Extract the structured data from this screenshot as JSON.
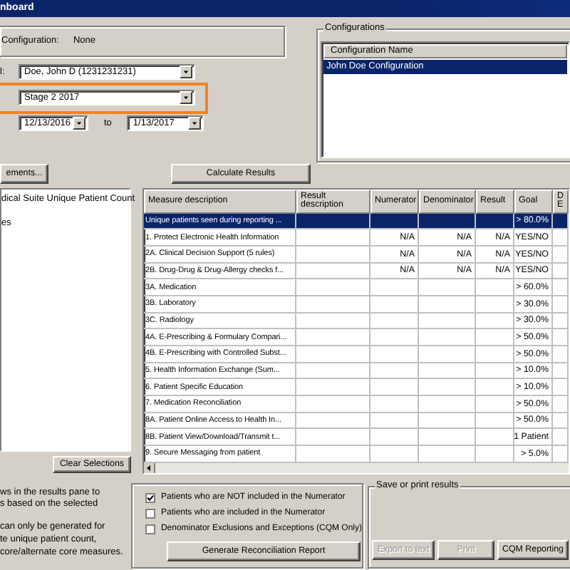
{
  "window": {
    "title": "nboard"
  },
  "configuration": {
    "label": "Configuration:",
    "value": "None"
  },
  "provider": {
    "label": "l:",
    "value": "Doe, John D (1231231231)"
  },
  "stage": {
    "value": "Stage 2 2017",
    "highlighted": true
  },
  "date_range": {
    "from": "12/13/2016",
    "separator": "to",
    "to": "1/13/2017"
  },
  "buttons": [
    {
      "label": "ements...",
      "disabled": false
    },
    {
      "label": "Calculate Results",
      "disabled": false
    }
  ],
  "configurations": {
    "title": "Configurations",
    "column": "Configuration Name",
    "items": [
      {
        "name": "John Doe Configuration",
        "selected": true
      }
    ]
  },
  "measure_list": {
    "items": [
      "dical Suite Unique Patient Count",
      "es"
    ]
  },
  "clear_button": {
    "label": "Clear Selections",
    "disabled": false
  },
  "table": {
    "columns": [
      "Measure description",
      "Result description",
      "Numerator",
      "Denominator",
      "Result",
      "Goal",
      "D E"
    ],
    "rows": [
      {
        "measure": "Unique patients seen during reporting ...",
        "goal": "> 80.0%",
        "selected": true
      },
      {
        "measure": "1. Protect Electronic Health Information",
        "numerator": "N/A",
        "denominator": "N/A",
        "result": "N/A",
        "goal": "YES/NO",
        "selected": false
      },
      {
        "measure": "2A. Clinical Decision Support (5 rules)",
        "numerator": "N/A",
        "denominator": "N/A",
        "result": "N/A",
        "goal": "YES/NO",
        "selected": false
      },
      {
        "measure": "2B. Drug-Drug & Drug-Allergy checks f...",
        "numerator": "N/A",
        "denominator": "N/A",
        "result": "N/A",
        "goal": "YES/NO",
        "selected": false
      },
      {
        "measure": "3A. Medication",
        "goal": "> 60.0%",
        "selected": false
      },
      {
        "measure": "3B. Laboratory",
        "goal": "> 30.0%",
        "selected": false
      },
      {
        "measure": "3C. Radiology",
        "goal": "> 30.0%",
        "selected": false
      },
      {
        "measure": "4A. E-Prescribing & Formulary Compari...",
        "goal": "> 50.0%",
        "selected": false
      },
      {
        "measure": "4B. E-Prescribing with Controlled Subst...",
        "goal": "> 50.0%",
        "selected": false
      },
      {
        "measure": "5. Health Information Exchange (Sum...",
        "goal": "> 10.0%",
        "selected": false
      },
      {
        "measure": "6. Patient Specific Education",
        "goal": "> 10.0%",
        "selected": false
      },
      {
        "measure": "7. Medication Reconciliation",
        "goal": "> 50.0%",
        "selected": false
      },
      {
        "measure": "8A. Patient Online Access to Health In...",
        "goal": "> 50.0%",
        "selected": false
      },
      {
        "measure": "8B. Patient View/Download/Transmit t...",
        "goal": "1 Patient",
        "selected": false
      },
      {
        "measure": "9. Secure Messaging from patient",
        "goal": "> 5.0%",
        "selected": false
      }
    ]
  },
  "notes": [
    [
      "ws in the results pane to",
      "s based on the selected"
    ],
    [
      "can only be generated for",
      "te unique patient count,",
      "core/alternate core measures."
    ]
  ],
  "reconciliation": {
    "options": [
      {
        "label": "Patients who are NOT included in the Numerator",
        "checked": true
      },
      {
        "label": "Patients who are included in the Numerator",
        "checked": false
      },
      {
        "label": "Denominator Exclusions and Exceptions (CQM Only)",
        "checked": false
      }
    ],
    "button": {
      "label": "Generate Reconciliation Report",
      "disabled": false
    }
  },
  "save_print": {
    "title": "Save or print results",
    "buttons": [
      {
        "label": "Export to text",
        "disabled": true
      },
      {
        "label": "Print",
        "disabled": true
      },
      {
        "label": "CQM Reporting",
        "disabled": false
      }
    ]
  }
}
